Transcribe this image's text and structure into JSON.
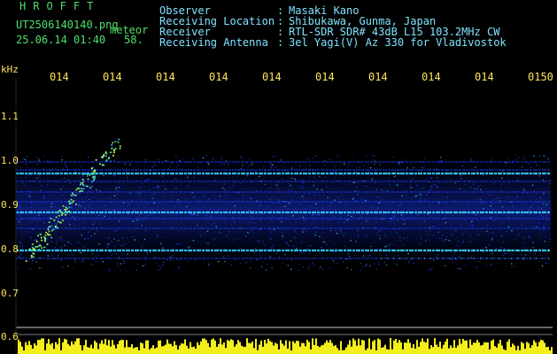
{
  "header": {
    "logo": "HROFFT",
    "filename": "UT2506140140.png",
    "event_type": "meteor",
    "datetime": "25.06.14 01:40",
    "count": "58.",
    "observer_key": "Observer",
    "observer_value": "Masaki Kano",
    "location_key": "Receiving Location",
    "location_value": "Shibukawa, Gunma, Japan",
    "receiver_key": "Receiver",
    "receiver_value": "RTL-SDR SDR# 43dB L15 103.2MHz CW",
    "antenna_key": "Receiving Antenna",
    "antenna_value": "3el Yagi(V) Az 330 for Vladivostok",
    "colon": ":"
  },
  "axis": {
    "unit": "kHz",
    "time_ticks": [
      "014",
      "014",
      "014",
      "014",
      "014",
      "014",
      "014",
      "014",
      "014",
      "0150"
    ],
    "freq_ticks": [
      "1.1",
      "1.0",
      "0.9",
      "0.8",
      "0.7",
      "0.6"
    ]
  },
  "colors": {
    "label_cyan": "#7fe3ff",
    "tick_yellow": "#ffe45c",
    "logo_green": "#4de06a",
    "signal_band": "#35c4ff",
    "noise_blue": "#1a3cff",
    "amplitude_yellow": "#f4ef1a"
  }
}
